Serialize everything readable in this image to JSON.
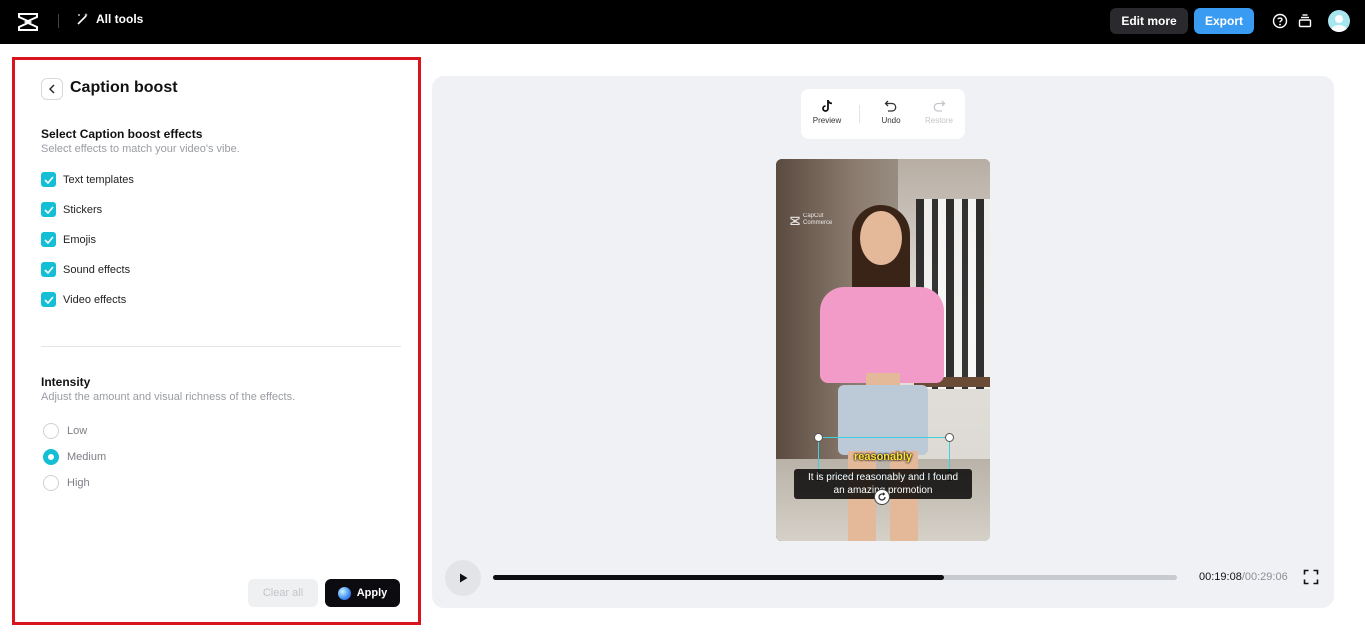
{
  "topbar": {
    "all_tools_label": "All tools",
    "edit_more_label": "Edit more",
    "export_label": "Export",
    "icons": [
      "capcut-logo-icon",
      "magic-wand-icon",
      "help-icon",
      "stack-icon",
      "avatar"
    ]
  },
  "panel": {
    "title": "Caption boost",
    "effects_section": {
      "title": "Select Caption boost effects",
      "subtitle": "Select effects to match your video's vibe.",
      "options": [
        {
          "label": "Text templates",
          "checked": true
        },
        {
          "label": "Stickers",
          "checked": true
        },
        {
          "label": "Emojis",
          "checked": true
        },
        {
          "label": "Sound effects",
          "checked": true
        },
        {
          "label": "Video effects",
          "checked": true
        }
      ]
    },
    "intensity_section": {
      "title": "Intensity",
      "subtitle": "Adjust the amount and visual richness of the effects.",
      "options": [
        {
          "label": "Low",
          "selected": false
        },
        {
          "label": "Medium",
          "selected": true
        },
        {
          "label": "High",
          "selected": false
        }
      ]
    },
    "clear_all_label": "Clear all",
    "apply_label": "Apply"
  },
  "preview": {
    "toolbar": {
      "preview_label": "Preview",
      "undo_label": "Undo",
      "restore_label": "Restore"
    },
    "video": {
      "watermark_line1": "CapCut",
      "watermark_line2": "Commerce",
      "caption_highlight": "reasonably",
      "caption_line1": "It is priced reasonably and I found",
      "caption_line2": "an amazing promotion"
    },
    "player": {
      "current_time": "00:19:08",
      "total_time": "/00:29:06",
      "progress_fraction": 0.66
    }
  },
  "colors": {
    "accent_cyan": "#14bfd6",
    "export_blue": "#3a9bf2",
    "highlight_red_border": "#d9141f"
  }
}
